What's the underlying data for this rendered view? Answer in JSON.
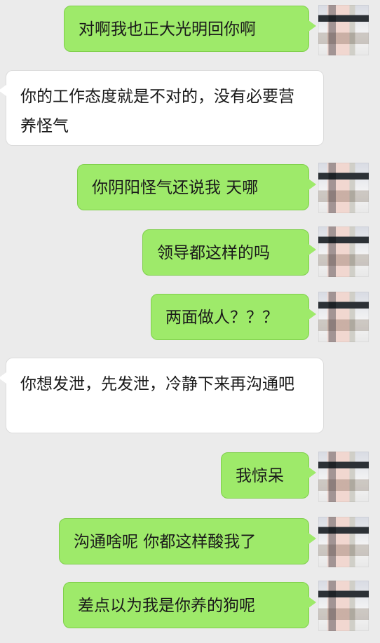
{
  "messages": [
    {
      "side": "right",
      "text": "对啊我也正大光明回你啊"
    },
    {
      "side": "left",
      "text": "你的工作态度就是不对的，没有必要营养怪气"
    },
    {
      "side": "right",
      "text": "你阴阳怪气还说我 天哪"
    },
    {
      "side": "right",
      "text": "领导都这样的吗"
    },
    {
      "side": "right",
      "text": "两面做人？？？"
    },
    {
      "side": "left",
      "text": "你想发泄，先发泄，冷静下来再沟通吧"
    },
    {
      "side": "right",
      "text": "我惊呆"
    },
    {
      "side": "right",
      "text": "沟通啥呢 你都这样酸我了"
    },
    {
      "side": "right",
      "text": "差点以为我是你养的狗呢"
    }
  ],
  "colors": {
    "background": "#ebebeb",
    "sent_bubble": "#9eea6a",
    "received_bubble": "#ffffff"
  },
  "icons": [
    "pixelated-avatar-icon"
  ]
}
